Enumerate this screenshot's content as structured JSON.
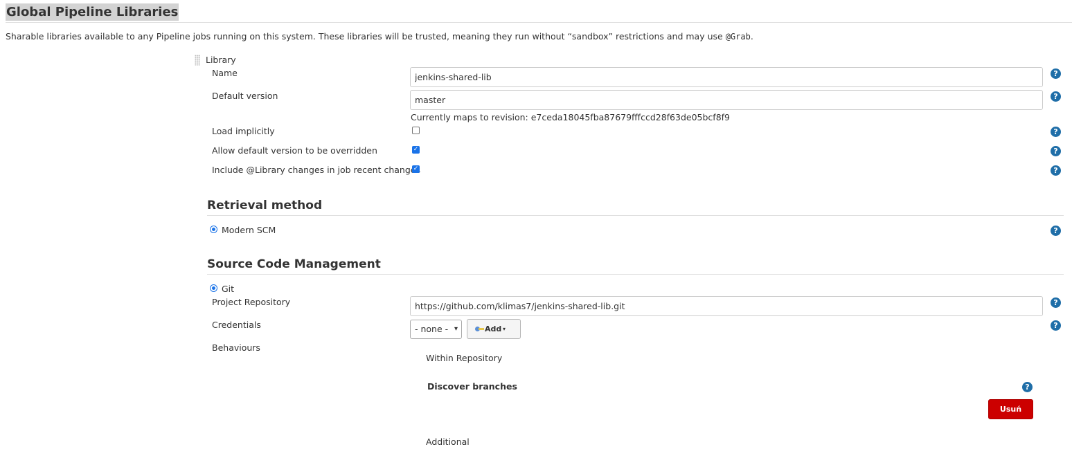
{
  "section": {
    "title": "Global Pipeline Libraries",
    "description_before": "Sharable libraries available to any Pipeline jobs running on this system. These libraries will be trusted, meaning they run without “sandbox” restrictions and may use ",
    "description_code": "@Grab",
    "description_after": "."
  },
  "library": {
    "header": "Library",
    "name_label": "Name",
    "name_value": "jenkins-shared-lib",
    "default_version_label": "Default version",
    "default_version_value": "master",
    "revision_text": "Currently maps to revision: e7ceda18045fba87679fffccd28f63de05bcf8f9",
    "load_implicitly_label": "Load implicitly",
    "load_implicitly_checked": false,
    "allow_override_label": "Allow default version to be overridden",
    "allow_override_checked": true,
    "include_changes_label": "Include @Library changes in job recent changes",
    "include_changes_checked": true
  },
  "retrieval": {
    "heading": "Retrieval method",
    "option_label": "Modern SCM"
  },
  "scm": {
    "heading": "Source Code Management",
    "git_label": "Git",
    "project_repo_label": "Project Repository",
    "project_repo_value": "https://github.com/klimas7/jenkins-shared-lib.git",
    "credentials_label": "Credentials",
    "credentials_value": "- none -",
    "add_button_label": "Add",
    "behaviours_label": "Behaviours",
    "within_repository_label": "Within Repository",
    "discover_branches_label": "Discover branches",
    "remove_button_label": "Usuń",
    "additional_label": "Additional"
  },
  "help_glyph": "?",
  "check_glyph": "✓",
  "caret_glyph": "▾",
  "colors": {
    "help_icon": "#1f6ea8",
    "checkbox": "#1a73e8",
    "remove_button": "#cc0000"
  }
}
